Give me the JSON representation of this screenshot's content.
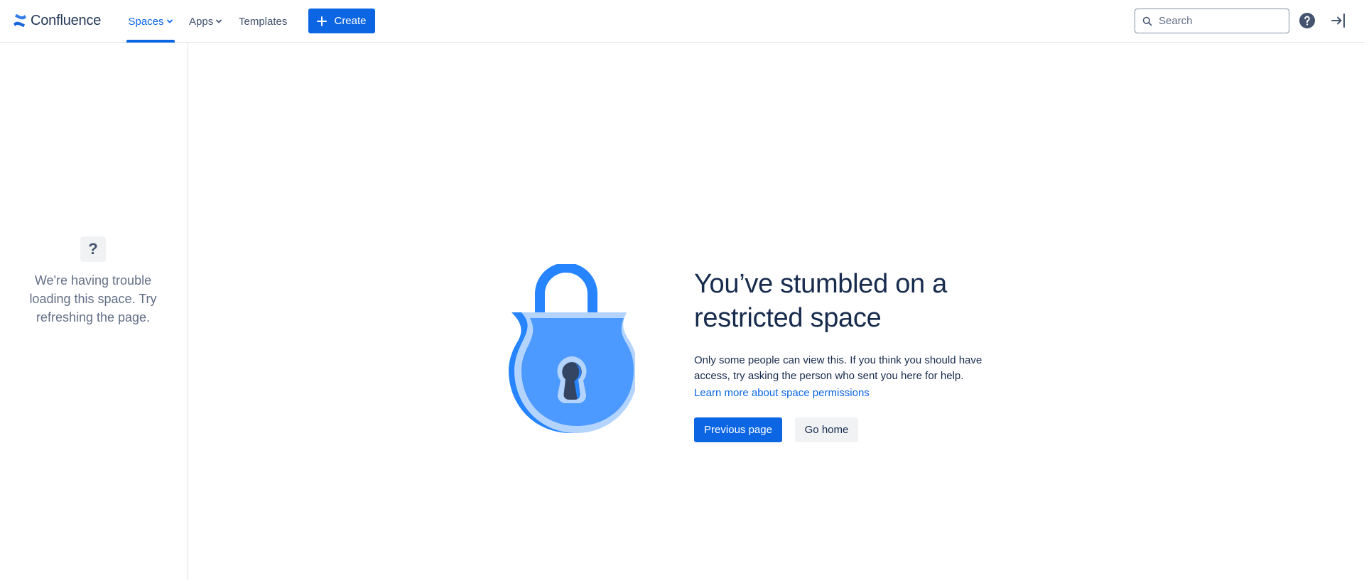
{
  "header": {
    "logo_text": "Confluence",
    "nav": [
      {
        "label": "Spaces",
        "active": true,
        "has_dropdown": true
      },
      {
        "label": "Apps",
        "active": false,
        "has_dropdown": true
      },
      {
        "label": "Templates",
        "active": false,
        "has_dropdown": false
      }
    ],
    "create_label": "Create",
    "search_placeholder": "Search",
    "icons": [
      "confluence-logo-icon",
      "chevron-down-icon",
      "plus-icon",
      "search-icon",
      "help-icon",
      "log-in-icon"
    ]
  },
  "sidebar": {
    "icon_glyph": "?",
    "message": "We're having trouble loading this space. Try refreshing the page."
  },
  "main": {
    "heading": "You’ve stumbled on a restricted space",
    "description": "Only some people can view this. If you think you should have access, try asking the person who sent you here for help.",
    "learn_more": "Learn more about space permissions",
    "primary_button": "Previous page",
    "secondary_button": "Go home"
  },
  "colors": {
    "brand_blue": "#0c66e4",
    "text": "#172b4d",
    "subtle_text": "#626f86",
    "lock_dark": "#2684ff",
    "lock_mid": "#4c9aff",
    "lock_light": "#b3d4ff",
    "keyhole": "#344563"
  }
}
